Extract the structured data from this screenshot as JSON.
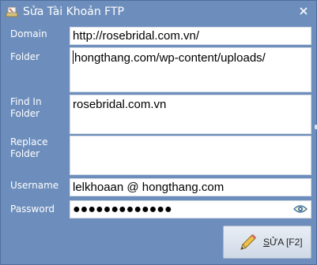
{
  "window": {
    "title": "Sửa Tài Khoản FTP",
    "icons": {
      "app": "ftp-account-icon",
      "close": "close-icon"
    }
  },
  "form": {
    "domain": {
      "label": "Domain",
      "value": "http://rosebridal.com.vn/"
    },
    "folder": {
      "label": "Folder",
      "value": "hongthang.com/wp-content/uploads/"
    },
    "find_in_folder": {
      "label": "Find In Folder",
      "value": "rosebridal.com.vn"
    },
    "replace_folder": {
      "label": "Replace Folder",
      "value": ""
    },
    "username": {
      "label": "Username",
      "value": "lelkhoaan @ hongthang.com"
    },
    "password": {
      "label": "Password",
      "value": "●●●●●●●●●●●●●",
      "toggle_icon": "eye-icon"
    }
  },
  "buttons": {
    "edit": {
      "underlined": "S",
      "rest": "ỬA [F2]",
      "icon": "pencil-icon"
    }
  },
  "colors": {
    "background": "#6d8ebc",
    "text": "#ffffff",
    "field": "#ffffff"
  }
}
